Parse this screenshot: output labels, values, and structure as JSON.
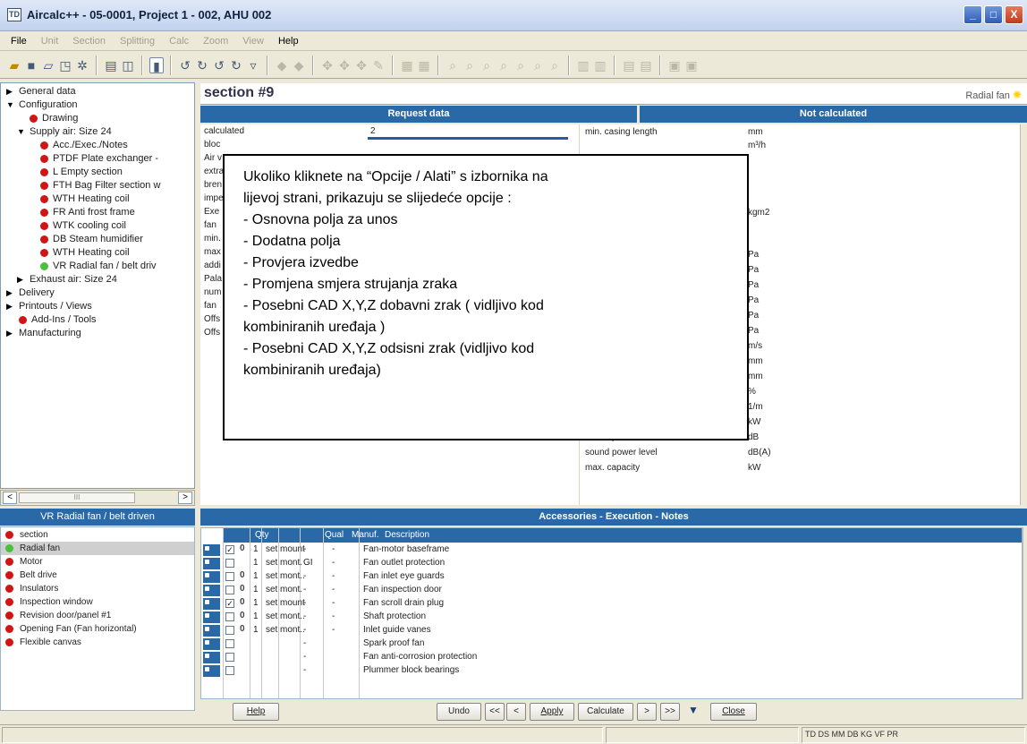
{
  "window": {
    "icon_text": "TD",
    "title": "Aircalc++ - 05-0001, Project 1 - 002, AHU 002",
    "min_label": "_",
    "max_label": "□",
    "close_label": "X"
  },
  "menu": [
    "File",
    "Unit",
    "Section",
    "Splitting",
    "Calc",
    "Zoom",
    "View",
    "Help"
  ],
  "tree": [
    {
      "label": "General data",
      "level": 0,
      "arrow": "▶",
      "bullet": ""
    },
    {
      "label": "Configuration",
      "level": 0,
      "arrow": "▼",
      "bullet": ""
    },
    {
      "label": "Drawing",
      "level": 1,
      "arrow": "",
      "bullet": "red"
    },
    {
      "label": "Supply air: Size 24",
      "level": 1,
      "arrow": "▼",
      "bullet": ""
    },
    {
      "label": "Acc./Exec./Notes",
      "level": 2,
      "arrow": "",
      "bullet": "red"
    },
    {
      "label": "PTDF Plate exchanger -",
      "level": 2,
      "arrow": "",
      "bullet": "red"
    },
    {
      "label": "L Empty section",
      "level": 2,
      "arrow": "",
      "bullet": "red"
    },
    {
      "label": "FTH Bag Filter section w",
      "level": 2,
      "arrow": "",
      "bullet": "red"
    },
    {
      "label": "WTH Heating coil",
      "level": 2,
      "arrow": "",
      "bullet": "red"
    },
    {
      "label": "FR Anti frost frame",
      "level": 2,
      "arrow": "",
      "bullet": "red"
    },
    {
      "label": "WTK cooling coil",
      "level": 2,
      "arrow": "",
      "bullet": "red"
    },
    {
      "label": "DB Steam humidifier",
      "level": 2,
      "arrow": "",
      "bullet": "red"
    },
    {
      "label": "WTH Heating coil",
      "level": 2,
      "arrow": "",
      "bullet": "red"
    },
    {
      "label": "VR Radial fan / belt driv",
      "level": 2,
      "arrow": "",
      "bullet": "green"
    },
    {
      "label": "Exhaust air: Size 24",
      "level": 1,
      "arrow": "▶",
      "bullet": ""
    },
    {
      "label": "Delivery",
      "level": 0,
      "arrow": "▶",
      "bullet": ""
    },
    {
      "label": "Printouts / Views",
      "level": 0,
      "arrow": "▶",
      "bullet": ""
    },
    {
      "label": "Add-Ins / Tools",
      "level": 0,
      "arrow": "",
      "bullet": "red"
    },
    {
      "label": "Manufacturing",
      "level": 0,
      "arrow": "▶",
      "bullet": ""
    }
  ],
  "section": {
    "title": "section #9",
    "type_label": "Radial fan"
  },
  "request": {
    "header": "Request data",
    "rows": [
      {
        "label": "calculated",
        "value": "2"
      },
      {
        "label": "bloc",
        "value": ""
      },
      {
        "label": "Air v",
        "value": ""
      },
      {
        "label": "extra",
        "value": ""
      },
      {
        "label": "bren",
        "value": ""
      },
      {
        "label": "impe",
        "value": ""
      },
      {
        "label": "Exe",
        "value": ""
      },
      {
        "label": "fan",
        "value": ""
      },
      {
        "label": "min.",
        "value": ""
      },
      {
        "label": "max",
        "value": ""
      },
      {
        "label": "addi",
        "value": ""
      },
      {
        "label": "Pala",
        "value": ""
      },
      {
        "label": "num",
        "value": ""
      },
      {
        "label": "fan",
        "value": ""
      },
      {
        "label": "Offs",
        "value": ""
      },
      {
        "label": "Offs",
        "value": ""
      }
    ]
  },
  "results": {
    "header": "Not calculated",
    "rows": [
      {
        "label": "min. casing length",
        "unit": "mm"
      },
      {
        "label": "",
        "unit": "m³/h"
      },
      {
        "label": "",
        "unit": ""
      },
      {
        "label": "",
        "unit": ""
      },
      {
        "label": "",
        "unit": ""
      },
      {
        "label": "",
        "unit": ""
      },
      {
        "label": "",
        "unit": "kgm2"
      },
      {
        "label": "",
        "unit": ""
      },
      {
        "label": "",
        "unit": ""
      },
      {
        "label": "",
        "unit": "Pa"
      },
      {
        "label": "",
        "unit": "Pa"
      },
      {
        "label": "",
        "unit": "Pa"
      },
      {
        "label": "",
        "unit": "Pa"
      },
      {
        "label": "",
        "unit": "Pa"
      },
      {
        "label": "",
        "unit": "Pa"
      },
      {
        "label": "",
        "unit": "m/s"
      },
      {
        "label": "",
        "unit": "mm"
      },
      {
        "label": "",
        "unit": "mm"
      },
      {
        "label": "",
        "unit": "%"
      },
      {
        "label": "",
        "unit": "1/m"
      },
      {
        "label": "shaft capacity",
        "unit": "kW"
      },
      {
        "label": "sound power level",
        "unit": "dB"
      },
      {
        "label": "sound power level",
        "unit": "dB(A)"
      },
      {
        "label": "max. capacity",
        "unit": "kW"
      }
    ]
  },
  "overlay": {
    "lines": [
      "Ukoliko kliknete na “Opcije / Alati” s izbornika na",
      "lijevoj strani, prikazuju se slijedeće opcije :",
      "- Osnovna polja za unos",
      "- Dodatna polja",
      "- Provjera izvedbe",
      "- Promjena smjera strujanja zraka",
      "- Posebni CAD X,Y,Z dobavni zrak ( vidljivo kod",
      "kombiniranih uređaja )",
      "- Posebni CAD X,Y,Z odsisni zrak (vidljivo kod",
      "kombiniranih uređaja)"
    ]
  },
  "components": {
    "header": "VR Radial fan / belt driven",
    "items": [
      {
        "label": "section",
        "bullet": "red",
        "selected": false
      },
      {
        "label": "Radial fan",
        "bullet": "green",
        "selected": true
      },
      {
        "label": "Motor",
        "bullet": "red",
        "selected": false
      },
      {
        "label": "Belt drive",
        "bullet": "red",
        "selected": false
      },
      {
        "label": "Insulators",
        "bullet": "red",
        "selected": false
      },
      {
        "label": "Inspection window",
        "bullet": "red",
        "selected": false
      },
      {
        "label": "Revision door/panel #1",
        "bullet": "red",
        "selected": false
      },
      {
        "label": "Opening Fan (Fan horizontal)",
        "bullet": "red",
        "selected": false
      },
      {
        "label": "Flexible canvas",
        "bullet": "red",
        "selected": false
      }
    ]
  },
  "accessories": {
    "header": "Accessories - Execution - Notes",
    "columns": {
      "qty": "Qty",
      "qual": "Qual",
      "manuf": "Manuf.",
      "desc": "Description"
    },
    "rows": [
      {
        "checked": true,
        "clip": "0",
        "qty": "1",
        "unit": "set",
        "mount": "mount",
        "qual": "-",
        "manuf": "-",
        "desc": "Fan-motor baseframe"
      },
      {
        "checked": false,
        "clip": "",
        "qty": "1",
        "unit": "set",
        "mount": "mont.",
        "qual": "GI",
        "manuf": "-",
        "desc": "Fan outlet protection"
      },
      {
        "checked": false,
        "clip": "0",
        "qty": "1",
        "unit": "set",
        "mount": "mont..",
        "qual": "-",
        "manuf": "-",
        "desc": "Fan inlet eye guards"
      },
      {
        "checked": false,
        "clip": "0",
        "qty": "1",
        "unit": "set",
        "mount": "mont.",
        "qual": "-",
        "manuf": "-",
        "desc": "Fan inspection door"
      },
      {
        "checked": true,
        "clip": "0",
        "qty": "1",
        "unit": "set",
        "mount": "mount",
        "qual": "-",
        "manuf": "-",
        "desc": "Fan scroll drain plug"
      },
      {
        "checked": false,
        "clip": "0",
        "qty": "1",
        "unit": "set",
        "mount": "mont..",
        "qual": "-",
        "manuf": "-",
        "desc": "Shaft protection"
      },
      {
        "checked": false,
        "clip": "0",
        "qty": "1",
        "unit": "set",
        "mount": "mont..",
        "qual": "-",
        "manuf": "-",
        "desc": "Inlet guide vanes"
      },
      {
        "checked": false,
        "clip": "",
        "qty": "",
        "unit": "",
        "mount": "",
        "qual": "-",
        "manuf": "",
        "desc": "Spark proof fan"
      },
      {
        "checked": false,
        "clip": "",
        "qty": "",
        "unit": "",
        "mount": "",
        "qual": "-",
        "manuf": "",
        "desc": "Fan anti-corrosion protection"
      },
      {
        "checked": false,
        "clip": "",
        "qty": "",
        "unit": "",
        "mount": "",
        "qual": "-",
        "manuf": "",
        "desc": "Plummer block bearings"
      }
    ]
  },
  "buttons": {
    "help": "Help",
    "undo": "Undo",
    "first": "<<",
    "prev": "<",
    "apply": "Apply",
    "calculate": "Calculate",
    "next": ">",
    "last": ">>",
    "close": "Close"
  },
  "status": {
    "text": "TD DS MM DB   KG VF PR"
  }
}
